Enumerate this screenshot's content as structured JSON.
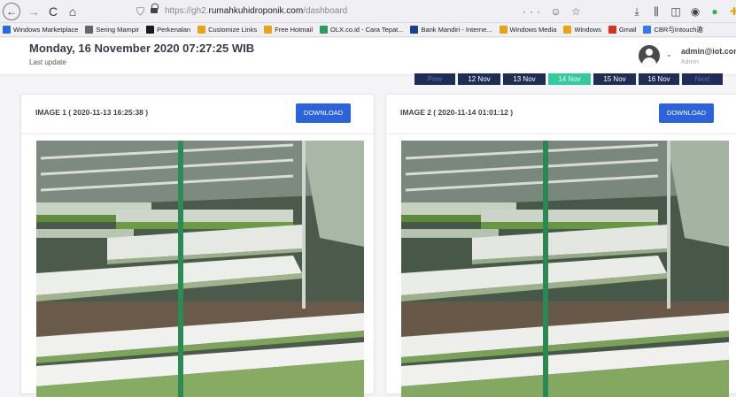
{
  "browser": {
    "url_prefix": "https://gh2.",
    "url_domain": "rumahkuhidroponik.com",
    "url_path": "/dashboard",
    "url_actions": "··· ☺ ☆"
  },
  "bookmarks": [
    {
      "label": "Windows Marketplace",
      "color": "#2a6cd6"
    },
    {
      "label": "Sering Mampir",
      "color": "#666666"
    },
    {
      "label": "Perkenalan",
      "color": "#1a1a1a"
    },
    {
      "label": "Customize Links",
      "color": "#e8a419"
    },
    {
      "label": "Free Hotmail",
      "color": "#e8a419"
    },
    {
      "label": "OLX.co.id - Cara Tepat...",
      "color": "#2e9b58"
    },
    {
      "label": "Bank Mandiri - Interne...",
      "color": "#1d3f8f"
    },
    {
      "label": "Windows Media",
      "color": "#e8a419"
    },
    {
      "label": "Windows",
      "color": "#e8a419"
    },
    {
      "label": "Gmail",
      "color": "#d93025"
    },
    {
      "label": "CBR与Intouch邀",
      "color": "#3b78e7"
    }
  ],
  "header": {
    "date": "Monday, 16 November 2020 07:27:25 WIB",
    "last_update": "Last update",
    "user_email": "admin@iot.com",
    "user_role": "Admin"
  },
  "pager": {
    "prev": "Prev",
    "days": [
      "12 Nov",
      "13 Nov",
      "14 Nov",
      "15 Nov",
      "16 Nov"
    ],
    "active": "14 Nov",
    "next": "Next"
  },
  "images": [
    {
      "title": "IMAGE 1 ( 2020-11-13 16:25:38 )",
      "download": "DOWNLOAD"
    },
    {
      "title": "IMAGE 2 ( 2020-11-14 01:01:12 )",
      "download": "DOWNLOAD"
    }
  ],
  "colors": {
    "pager_bg": "#1f2d55",
    "pager_active": "#35c9a0",
    "download_btn": "#2c63d9"
  }
}
